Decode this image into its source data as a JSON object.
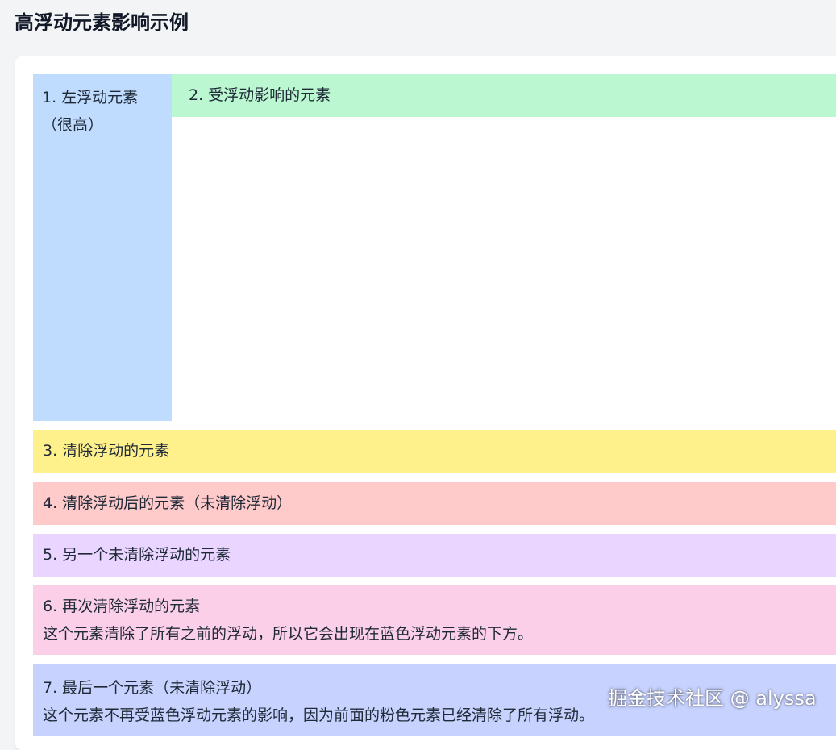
{
  "page": {
    "title": "高浮动元素影响示例"
  },
  "boxes": {
    "float_left": {
      "line1": "1. 左浮动元素",
      "line2": "（很高）"
    },
    "affected": {
      "text": "2. 受浮动影响的元素"
    },
    "clear_1": {
      "text": "3. 清除浮动的元素"
    },
    "after_clear": {
      "text": "4. 清除浮动后的元素（未清除浮动）"
    },
    "another": {
      "text": "5. 另一个未清除浮动的元素"
    },
    "clear_again": {
      "title": "6. 再次清除浮动的元素",
      "desc": "这个元素清除了所有之前的浮动，所以它会出现在蓝色浮动元素的下方。"
    },
    "last": {
      "title": "7. 最后一个元素（未清除浮动）",
      "desc": "这个元素不再受蓝色浮动元素的影响，因为前面的粉色元素已经清除了所有浮动。"
    }
  },
  "watermark": {
    "text": "掘金技术社区 @ alyssa"
  },
  "colors": {
    "blue": "#bfdbfe",
    "green": "#bbf7d0",
    "yellow": "#fef08a",
    "red": "#fecaca",
    "purple": "#e9d5ff",
    "pink": "#fbcfe8",
    "indigo": "#c7d2fe"
  }
}
